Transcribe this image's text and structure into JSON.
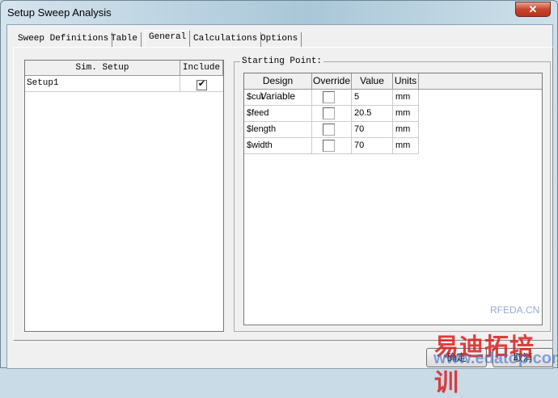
{
  "window": {
    "title": "Setup Sweep Analysis",
    "close": "✕"
  },
  "tabs": [
    {
      "label": "Sweep Definitions"
    },
    {
      "label": "Table"
    },
    {
      "label": "General"
    },
    {
      "label": "Calculations"
    },
    {
      "label": "Options"
    }
  ],
  "active_tab": "General",
  "sim_list": {
    "headers": [
      "Sim. Setup",
      "Include"
    ],
    "rows": [
      {
        "name": "Setup1",
        "include": true,
        "mark": "✔"
      }
    ]
  },
  "starting_point": {
    "label": "Starting Point:",
    "headers": [
      "Design Variable",
      "Override",
      "Value",
      "Units"
    ],
    "rows": [
      {
        "variable": "$cut",
        "override": false,
        "value": "5",
        "units": "mm"
      },
      {
        "variable": "$feed",
        "override": false,
        "value": "20.5",
        "units": "mm"
      },
      {
        "variable": "$length",
        "override": false,
        "value": "70",
        "units": "mm"
      },
      {
        "variable": "$width",
        "override": false,
        "value": "70",
        "units": "mm"
      }
    ]
  },
  "buttons": {
    "ok": "确定",
    "cancel": "取消"
  },
  "watermark": {
    "site": "RFEDA.CN",
    "brand": "易迪拓培训",
    "url": "www.edatop.com"
  }
}
